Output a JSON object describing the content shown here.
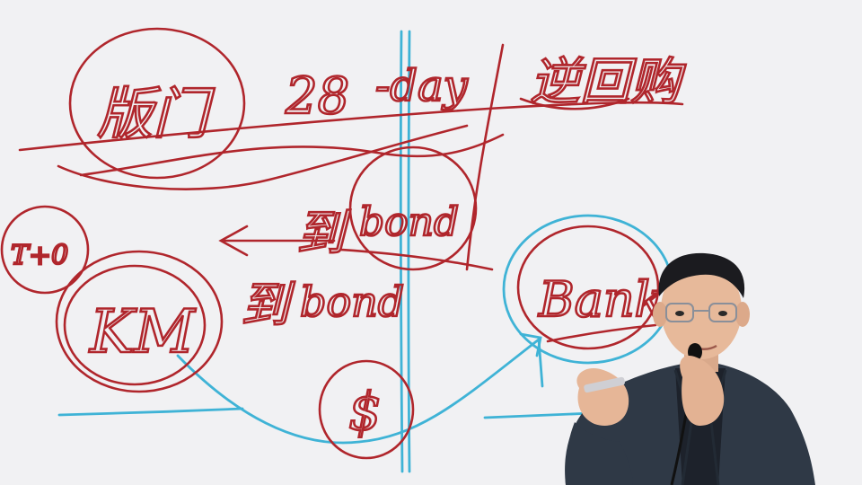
{
  "whiteboard": {
    "background": "#f1f1f3",
    "ink_red": "#b0262c",
    "ink_blue": "#3fb3d6",
    "words": {
      "topleft": "版门",
      "twentyeight": "28",
      "day": "-day",
      "chinese_right": "逆回购",
      "bond_upper": "bond",
      "bond_lower": "bond",
      "char_upper": "到",
      "char_lower": "到",
      "left_small": "T+0",
      "km": "KM",
      "dollar": "$",
      "bank": "Bank"
    }
  },
  "presenter": {
    "jacket": "#2f3946",
    "shirt": "#1d222b",
    "skin": "#e7b99a",
    "hair": "#1b1b1f"
  }
}
